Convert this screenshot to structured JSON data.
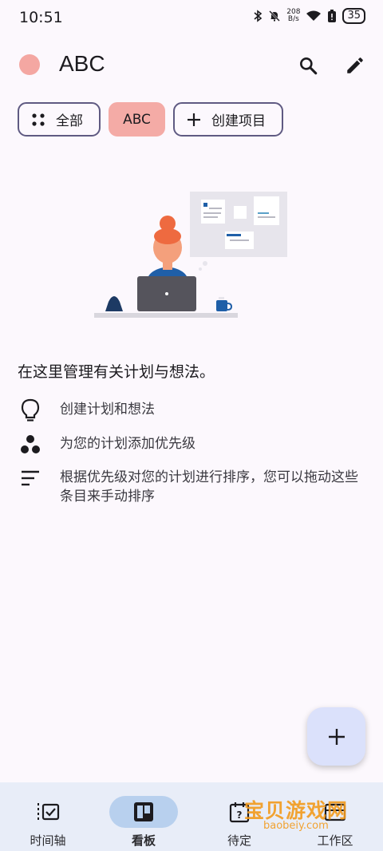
{
  "status_bar": {
    "time": "10:51",
    "net_speed_value": "208",
    "net_speed_unit": "B/s",
    "battery": "35"
  },
  "app_bar": {
    "title": "ABC",
    "project_color": "#f4a7a2"
  },
  "chips": [
    {
      "label": "全部",
      "icon": "grid-dots-icon",
      "selected": false
    },
    {
      "label": "ABC",
      "selected": true
    },
    {
      "label": "创建项目",
      "icon": "plus-icon",
      "selected": false
    }
  ],
  "empty_state": {
    "headline": "在这里管理有关计划与想法。",
    "features": [
      {
        "icon": "lightbulb-icon",
        "text": "创建计划和想法"
      },
      {
        "icon": "priority-dots-icon",
        "text": "为您的计划添加优先级"
      },
      {
        "icon": "sort-lines-icon",
        "text": "根据优先级对您的计划进行排序，您可以拖动这些条目来手动排序"
      }
    ]
  },
  "bottom_nav": [
    {
      "label": "时间轴",
      "icon": "timeline-icon",
      "selected": false
    },
    {
      "label": "看板",
      "icon": "board-icon",
      "selected": true
    },
    {
      "label": "待定",
      "icon": "calendar-question-icon",
      "selected": false
    },
    {
      "label": "工作区",
      "icon": "workspace-icon",
      "selected": false
    }
  ],
  "watermark": {
    "title": "宝贝游戏网",
    "url": "baobeiy.com"
  },
  "colors": {
    "background": "#fcf8fd",
    "chip_border": "#5f5a82",
    "chip_selected": "#f4aba6",
    "fab": "#dbe1fb",
    "nav_bg": "#e8edf8",
    "nav_indicator": "#b8d0ee"
  }
}
